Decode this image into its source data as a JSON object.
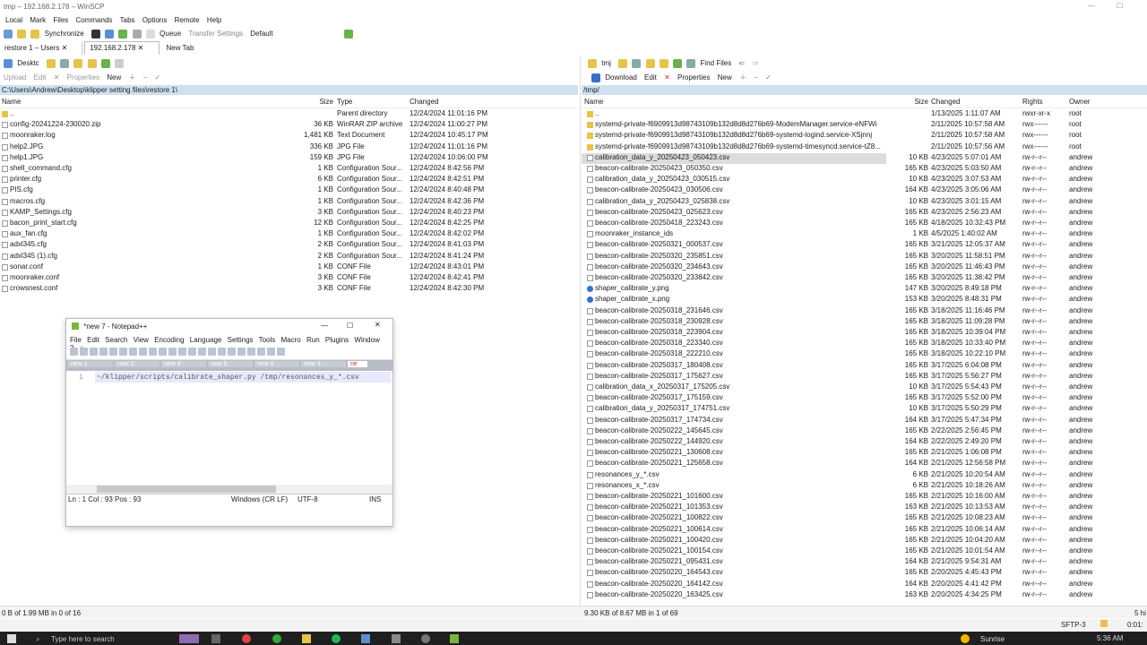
{
  "window": {
    "title": "tmp – 192.168.2.178 – WinSCP"
  },
  "menu": [
    "Local",
    "Mark",
    "Files",
    "Commands",
    "Tabs",
    "Options",
    "Remote",
    "Help"
  ],
  "toolbar": {
    "synchronize": "Synchronize",
    "queue": "Queue",
    "transfer_label": "Transfer Settings",
    "transfer_value": "Default"
  },
  "tabs": [
    {
      "label": "restore 1 – Users"
    },
    {
      "label": "192.168.2.178"
    },
    {
      "label": "New Tab"
    }
  ],
  "left": {
    "drive": "Desktc",
    "upload": "Upload",
    "edit": "Edit",
    "properties": "Properties",
    "new": "New",
    "path": "C:\\Users\\Andrew\\Desktop\\klipper setting files\\restore 1\\",
    "columns": {
      "name": "Name",
      "size": "Size",
      "type": "Type",
      "changed": "Changed"
    },
    "files": [
      {
        "name": "..",
        "size": "",
        "type": "Parent directory",
        "changed": "12/24/2024 11:01:16 PM",
        "icon": "folder"
      },
      {
        "name": "config-20241224-230020.zip",
        "size": "36 KB",
        "type": "WinRAR ZIP archive",
        "changed": "12/24/2024 11:00:27 PM",
        "icon": "file"
      },
      {
        "name": "moonraker.log",
        "size": "1,481 KB",
        "type": "Text Document",
        "changed": "12/24/2024 10:45:17 PM",
        "icon": "file"
      },
      {
        "name": "help2.JPG",
        "size": "336 KB",
        "type": "JPG File",
        "changed": "12/24/2024 11:01:16 PM",
        "icon": "file"
      },
      {
        "name": "help1.JPG",
        "size": "159 KB",
        "type": "JPG File",
        "changed": "12/24/2024 10:06:00 PM",
        "icon": "file"
      },
      {
        "name": "shell_command.cfg",
        "size": "1 KB",
        "type": "Configuration Sour...",
        "changed": "12/24/2024 8:42:56 PM",
        "icon": "file"
      },
      {
        "name": "printer.cfg",
        "size": "6 KB",
        "type": "Configuration Sour...",
        "changed": "12/24/2024 8:42:51 PM",
        "icon": "file"
      },
      {
        "name": "PIS.cfg",
        "size": "1 KB",
        "type": "Configuration Sour...",
        "changed": "12/24/2024 8:40:48 PM",
        "icon": "file"
      },
      {
        "name": "macros.cfg",
        "size": "1 KB",
        "type": "Configuration Sour...",
        "changed": "12/24/2024 8:42:36 PM",
        "icon": "file"
      },
      {
        "name": "KAMP_Settings.cfg",
        "size": "3 KB",
        "type": "Configuration Sour...",
        "changed": "12/24/2024 8:40:23 PM",
        "icon": "file"
      },
      {
        "name": "bacon_print_start.cfg",
        "size": "12 KB",
        "type": "Configuration Sour...",
        "changed": "12/24/2024 8:42:25 PM",
        "icon": "file"
      },
      {
        "name": "aux_fan.cfg",
        "size": "1 KB",
        "type": "Configuration Sour...",
        "changed": "12/24/2024 8:42:02 PM",
        "icon": "file"
      },
      {
        "name": "adxl345.cfg",
        "size": "2 KB",
        "type": "Configuration Sour...",
        "changed": "12/24/2024 8:41:03 PM",
        "icon": "file"
      },
      {
        "name": "adxl345 (1).cfg",
        "size": "2 KB",
        "type": "Configuration Sour...",
        "changed": "12/24/2024 8:41:24 PM",
        "icon": "file"
      },
      {
        "name": "sonar.conf",
        "size": "1 KB",
        "type": "CONF File",
        "changed": "12/24/2024 8:43:01 PM",
        "icon": "file"
      },
      {
        "name": "moonraker.conf",
        "size": "3 KB",
        "type": "CONF File",
        "changed": "12/24/2024 8:42:41 PM",
        "icon": "file"
      },
      {
        "name": "crowsnest.conf",
        "size": "3 KB",
        "type": "CONF File",
        "changed": "12/24/2024 8:42:30 PM",
        "icon": "file"
      }
    ]
  },
  "right": {
    "drive": "tmj",
    "find": "Find Files",
    "download": "Download",
    "edit": "Edit",
    "properties": "Properties",
    "new": "New",
    "path": "/tmp/",
    "columns": {
      "name": "Name",
      "size": "Size",
      "changed": "Changed",
      "rights": "Rights",
      "owner": "Owner"
    },
    "files": [
      {
        "name": "..",
        "size": "",
        "changed": "1/13/2025 1:11:07 AM",
        "rights": "rwxr-xr-x",
        "owner": "root",
        "icon": "folder"
      },
      {
        "name": "systemd-private-f6909913d98743109b132d8d8d276b69-ModemManager.service-eNFWi",
        "size": "",
        "changed": "2/11/2025 10:57:58 AM",
        "rights": "rwx------",
        "owner": "root",
        "icon": "folder"
      },
      {
        "name": "systemd-private-f6909913d98743109b132d8d8d276b69-systemd-logind.service-XSjnnj",
        "size": "",
        "changed": "2/11/2025 10:57:58 AM",
        "rights": "rwx------",
        "owner": "root",
        "icon": "folder"
      },
      {
        "name": "systemd-private-f6909913d98743109b132d8d8d276b69-systemd-timesyncd.service-tZ8...",
        "size": "",
        "changed": "2/11/2025 10:57:56 AM",
        "rights": "rwx------",
        "owner": "root",
        "icon": "folder"
      },
      {
        "name": "calibration_data_y_20250423_050423.csv",
        "size": "10 KB",
        "changed": "4/23/2025 5:07:01 AM",
        "rights": "rw-r--r--",
        "owner": "andrew",
        "icon": "file",
        "sel": true
      },
      {
        "name": "beacon-calibrate-20250423_050350.csv",
        "size": "165 KB",
        "changed": "4/23/2025 5:03:50 AM",
        "rights": "rw-r--r--",
        "owner": "andrew",
        "icon": "file"
      },
      {
        "name": "calibration_data_y_20250423_030515.csv",
        "size": "10 KB",
        "changed": "4/23/2025 3:07:53 AM",
        "rights": "rw-r--r--",
        "owner": "andrew",
        "icon": "file"
      },
      {
        "name": "beacon-calibrate-20250423_030506.csv",
        "size": "164 KB",
        "changed": "4/23/2025 3:05:06 AM",
        "rights": "rw-r--r--",
        "owner": "andrew",
        "icon": "file"
      },
      {
        "name": "calibration_data_y_20250423_025838.csv",
        "size": "10 KB",
        "changed": "4/23/2025 3:01:15 AM",
        "rights": "rw-r--r--",
        "owner": "andrew",
        "icon": "file"
      },
      {
        "name": "beacon-calibrate-20250423_025623.csv",
        "size": "165 KB",
        "changed": "4/23/2025 2:56:23 AM",
        "rights": "rw-r--r--",
        "owner": "andrew",
        "icon": "file"
      },
      {
        "name": "beacon-calibrate-20250418_223243.csv",
        "size": "165 KB",
        "changed": "4/18/2025 10:32:43 PM",
        "rights": "rw-r--r--",
        "owner": "andrew",
        "icon": "file"
      },
      {
        "name": "moonraker_instance_ids",
        "size": "1 KB",
        "changed": "4/5/2025 1:40:02 AM",
        "rights": "rw-r--r--",
        "owner": "andrew",
        "icon": "file"
      },
      {
        "name": "beacon-calibrate-20250321_000537.csv",
        "size": "165 KB",
        "changed": "3/21/2025 12:05:37 AM",
        "rights": "rw-r--r--",
        "owner": "andrew",
        "icon": "file"
      },
      {
        "name": "beacon-calibrate-20250320_235851.csv",
        "size": "165 KB",
        "changed": "3/20/2025 11:58:51 PM",
        "rights": "rw-r--r--",
        "owner": "andrew",
        "icon": "file"
      },
      {
        "name": "beacon-calibrate-20250320_234643.csv",
        "size": "165 KB",
        "changed": "3/20/2025 11:46:43 PM",
        "rights": "rw-r--r--",
        "owner": "andrew",
        "icon": "file"
      },
      {
        "name": "beacon-calibrate-20250320_233842.csv",
        "size": "165 KB",
        "changed": "3/20/2025 11:38:42 PM",
        "rights": "rw-r--r--",
        "owner": "andrew",
        "icon": "file"
      },
      {
        "name": "shaper_calibrate_y.png",
        "size": "147 KB",
        "changed": "3/20/2025 8:49:18 PM",
        "rights": "rw-r--r--",
        "owner": "andrew",
        "icon": "png"
      },
      {
        "name": "shaper_calibrate_x.png",
        "size": "153 KB",
        "changed": "3/20/2025 8:48:31 PM",
        "rights": "rw-r--r--",
        "owner": "andrew",
        "icon": "png"
      },
      {
        "name": "beacon-calibrate-20250318_231646.csv",
        "size": "165 KB",
        "changed": "3/18/2025 11:16:46 PM",
        "rights": "rw-r--r--",
        "owner": "andrew",
        "icon": "file"
      },
      {
        "name": "beacon-calibrate-20250318_230928.csv",
        "size": "165 KB",
        "changed": "3/18/2025 11:09:28 PM",
        "rights": "rw-r--r--",
        "owner": "andrew",
        "icon": "file"
      },
      {
        "name": "beacon-calibrate-20250318_223904.csv",
        "size": "165 KB",
        "changed": "3/18/2025 10:39:04 PM",
        "rights": "rw-r--r--",
        "owner": "andrew",
        "icon": "file"
      },
      {
        "name": "beacon-calibrate-20250318_223340.csv",
        "size": "165 KB",
        "changed": "3/18/2025 10:33:40 PM",
        "rights": "rw-r--r--",
        "owner": "andrew",
        "icon": "file"
      },
      {
        "name": "beacon-calibrate-20250318_222210.csv",
        "size": "165 KB",
        "changed": "3/18/2025 10:22:10 PM",
        "rights": "rw-r--r--",
        "owner": "andrew",
        "icon": "file"
      },
      {
        "name": "beacon-calibrate-20250317_180408.csv",
        "size": "165 KB",
        "changed": "3/17/2025 6:04:08 PM",
        "rights": "rw-r--r--",
        "owner": "andrew",
        "icon": "file"
      },
      {
        "name": "beacon-calibrate-20250317_175627.csv",
        "size": "165 KB",
        "changed": "3/17/2025 5:56:27 PM",
        "rights": "rw-r--r--",
        "owner": "andrew",
        "icon": "file"
      },
      {
        "name": "calibration_data_x_20250317_175205.csv",
        "size": "10 KB",
        "changed": "3/17/2025 5:54:43 PM",
        "rights": "rw-r--r--",
        "owner": "andrew",
        "icon": "file"
      },
      {
        "name": "beacon-calibrate-20250317_175159.csv",
        "size": "165 KB",
        "changed": "3/17/2025 5:52:00 PM",
        "rights": "rw-r--r--",
        "owner": "andrew",
        "icon": "file"
      },
      {
        "name": "calibration_data_y_20250317_174751.csv",
        "size": "10 KB",
        "changed": "3/17/2025 5:50:29 PM",
        "rights": "rw-r--r--",
        "owner": "andrew",
        "icon": "file"
      },
      {
        "name": "beacon-calibrate-20250317_174734.csv",
        "size": "164 KB",
        "changed": "3/17/2025 5:47:34 PM",
        "rights": "rw-r--r--",
        "owner": "andrew",
        "icon": "file"
      },
      {
        "name": "beacon-calibrate-20250222_145645.csv",
        "size": "165 KB",
        "changed": "2/22/2025 2:56:45 PM",
        "rights": "rw-r--r--",
        "owner": "andrew",
        "icon": "file"
      },
      {
        "name": "beacon-calibrate-20250222_144920.csv",
        "size": "164 KB",
        "changed": "2/22/2025 2:49:20 PM",
        "rights": "rw-r--r--",
        "owner": "andrew",
        "icon": "file"
      },
      {
        "name": "beacon-calibrate-20250221_130608.csv",
        "size": "165 KB",
        "changed": "2/21/2025 1:06:08 PM",
        "rights": "rw-r--r--",
        "owner": "andrew",
        "icon": "file"
      },
      {
        "name": "beacon-calibrate-20250221_125658.csv",
        "size": "164 KB",
        "changed": "2/21/2025 12:56:58 PM",
        "rights": "rw-r--r--",
        "owner": "andrew",
        "icon": "file"
      },
      {
        "name": "resonances_y_*.csv",
        "size": "6 KB",
        "changed": "2/21/2025 10:20:54 AM",
        "rights": "rw-r--r--",
        "owner": "andrew",
        "icon": "file"
      },
      {
        "name": "resonances_x_*.csv",
        "size": "6 KB",
        "changed": "2/21/2025 10:18:26 AM",
        "rights": "rw-r--r--",
        "owner": "andrew",
        "icon": "file"
      },
      {
        "name": "beacon-calibrate-20250221_101600.csv",
        "size": "165 KB",
        "changed": "2/21/2025 10:16:00 AM",
        "rights": "rw-r--r--",
        "owner": "andrew",
        "icon": "file"
      },
      {
        "name": "beacon-calibrate-20250221_101353.csv",
        "size": "163 KB",
        "changed": "2/21/2025 10:13:53 AM",
        "rights": "rw-r--r--",
        "owner": "andrew",
        "icon": "file"
      },
      {
        "name": "beacon-calibrate-20250221_100822.csv",
        "size": "165 KB",
        "changed": "2/21/2025 10:08:23 AM",
        "rights": "rw-r--r--",
        "owner": "andrew",
        "icon": "file"
      },
      {
        "name": "beacon-calibrate-20250221_100614.csv",
        "size": "165 KB",
        "changed": "2/21/2025 10:06:14 AM",
        "rights": "rw-r--r--",
        "owner": "andrew",
        "icon": "file"
      },
      {
        "name": "beacon-calibrate-20250221_100420.csv",
        "size": "165 KB",
        "changed": "2/21/2025 10:04:20 AM",
        "rights": "rw-r--r--",
        "owner": "andrew",
        "icon": "file"
      },
      {
        "name": "beacon-calibrate-20250221_100154.csv",
        "size": "165 KB",
        "changed": "2/21/2025 10:01:54 AM",
        "rights": "rw-r--r--",
        "owner": "andrew",
        "icon": "file"
      },
      {
        "name": "beacon-calibrate-20250221_095431.csv",
        "size": "164 KB",
        "changed": "2/21/2025 9:54:31 AM",
        "rights": "rw-r--r--",
        "owner": "andrew",
        "icon": "file"
      },
      {
        "name": "beacon-calibrate-20250220_164543.csv",
        "size": "165 KB",
        "changed": "2/20/2025 4:45:43 PM",
        "rights": "rw-r--r--",
        "owner": "andrew",
        "icon": "file"
      },
      {
        "name": "beacon-calibrate-20250220_164142.csv",
        "size": "164 KB",
        "changed": "2/20/2025 4:41:42 PM",
        "rights": "rw-r--r--",
        "owner": "andrew",
        "icon": "file"
      },
      {
        "name": "beacon-calibrate-20250220_163425.csv",
        "size": "163 KB",
        "changed": "2/20/2025 4:34:25 PM",
        "rights": "rw-r--r--",
        "owner": "andrew",
        "icon": "file"
      }
    ]
  },
  "status": {
    "left": "0 B of 1.99 MB in 0 of 16",
    "right": "9.30 KB of 8.67 MB in 1 of 69",
    "protocol": "SFTP-3",
    "extra": "5 hi",
    "time": "0:01:"
  },
  "notepad": {
    "title": "*new 7 - Notepad++",
    "menu": [
      "File",
      "Edit",
      "Search",
      "View",
      "Encoding",
      "Language",
      "Settings",
      "Tools",
      "Macro",
      "Run",
      "Plugins",
      "Window",
      "?",
      "+"
    ],
    "tabs": [
      "new 1",
      "new 2",
      "new 4",
      "new 5",
      "new 6",
      "new 3",
      "ne"
    ],
    "line_number": "1",
    "line": "~/klipper/scripts/calibrate_shaper.py /tmp/resonances_y_*.csv",
    "status_pos": "Ln : 1    Col : 93    Pos : 93",
    "status_eol": "Windows (CR LF)",
    "status_enc": "UTF-8",
    "status_ins": "INS"
  },
  "taskbar": {
    "search": "Type here to search",
    "weather": "Sunrise",
    "clock": "5:36 AM"
  }
}
